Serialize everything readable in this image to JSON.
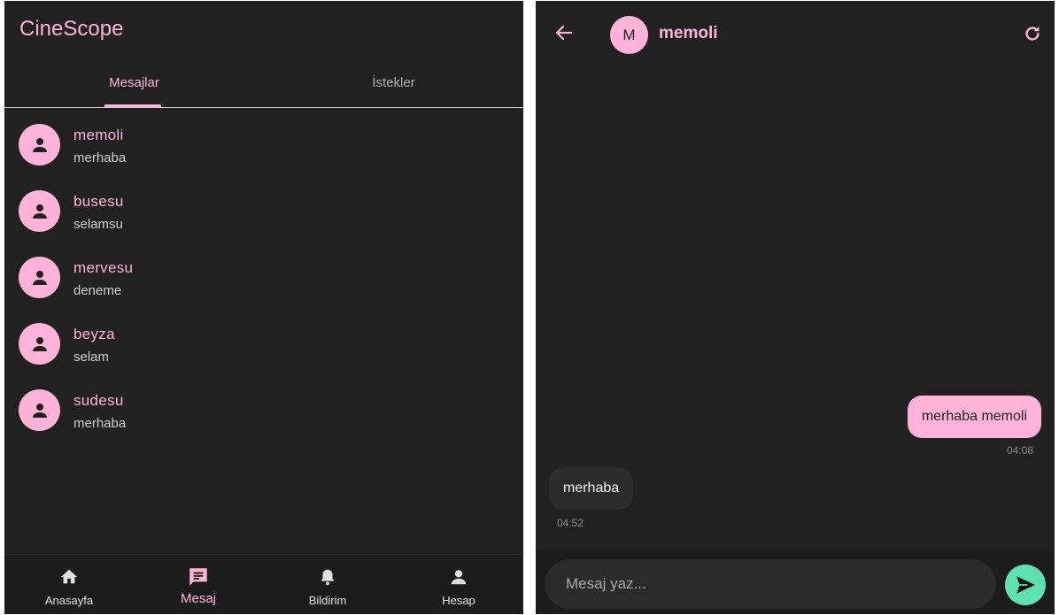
{
  "conversations": {
    "app_title": "CineScope",
    "tabs": [
      {
        "label": "Mesajlar",
        "active": true
      },
      {
        "label": "İstekler",
        "active": false
      }
    ],
    "items": [
      {
        "name": "memoli",
        "preview": "merhaba",
        "avatar_icon": "person-icon"
      },
      {
        "name": "busesu",
        "preview": "selamsu",
        "avatar_icon": "person-icon"
      },
      {
        "name": "mervesu",
        "preview": "deneme",
        "avatar_icon": "person-icon"
      },
      {
        "name": "beyza",
        "preview": "selam",
        "avatar_icon": "person-icon"
      },
      {
        "name": "sudesu",
        "preview": "merhaba",
        "avatar_icon": "person-icon"
      }
    ],
    "bottom_nav": [
      {
        "label": "Anasayfa",
        "icon": "home-icon",
        "active": false
      },
      {
        "label": "Mesaj",
        "icon": "message-icon",
        "active": true
      },
      {
        "label": "Bildirim",
        "icon": "bell-icon",
        "active": false
      },
      {
        "label": "Hesap",
        "icon": "person-icon",
        "active": false
      }
    ]
  },
  "chat": {
    "peer_initial": "M",
    "peer_name": "memoli",
    "messages": [
      {
        "direction": "outgoing",
        "text": "merhaba memoli",
        "time": "04:08"
      },
      {
        "direction": "incoming",
        "text": "merhaba",
        "time": "04:52"
      }
    ],
    "input_placeholder": "Mesaj yaz...",
    "input_value": ""
  },
  "colors": {
    "background": "#212121",
    "accent": "#ffb3d9",
    "send_button": "#5ee0b0",
    "incoming_bubble": "#2c2c2c",
    "muted_text": "#8a8a8a"
  }
}
